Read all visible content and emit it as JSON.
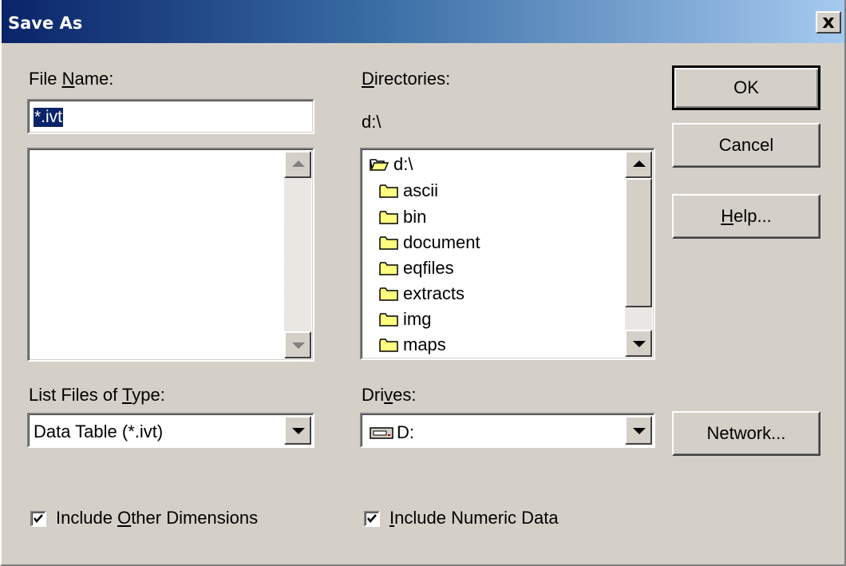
{
  "window": {
    "title": "Save As",
    "close_glyph": "x"
  },
  "file_name": {
    "label_pre": "File ",
    "label_key": "N",
    "label_post": "ame:",
    "value": "*.ivt"
  },
  "directories": {
    "label_pre": "",
    "label_key": "D",
    "label_post": "irectories:",
    "current_path": "d:\\",
    "items": [
      {
        "name": "d:\\",
        "icon": "open-folder-icon"
      },
      {
        "name": "ascii",
        "icon": "folder-icon"
      },
      {
        "name": "bin",
        "icon": "folder-icon"
      },
      {
        "name": "document",
        "icon": "folder-icon"
      },
      {
        "name": "eqfiles",
        "icon": "folder-icon"
      },
      {
        "name": "extracts",
        "icon": "folder-icon"
      },
      {
        "name": "img",
        "icon": "folder-icon"
      },
      {
        "name": "maps",
        "icon": "folder-icon"
      }
    ]
  },
  "file_type": {
    "label_pre": "List Files of ",
    "label_key": "T",
    "label_post": "ype:",
    "value": "Data Table (*.ivt)"
  },
  "drives": {
    "label_pre": "Dri",
    "label_key": "v",
    "label_post": "es:",
    "value": "D:",
    "icon": "drive-icon"
  },
  "buttons": {
    "ok": "OK",
    "cancel": "Cancel",
    "help_key": "H",
    "help_rest": "elp...",
    "network": "Network..."
  },
  "options": {
    "other_dims_pre": "Include ",
    "other_dims_key": "O",
    "other_dims_post": "ther Dimensions",
    "other_dims_checked": true,
    "numeric_key": "I",
    "numeric_post": "nclude Numeric Data",
    "numeric_checked": true
  },
  "colors": {
    "title_start": "#0a246a",
    "title_end": "#a6caf0",
    "face": "#d4d0c8",
    "selection": "#0a246a",
    "folder": "#ffff80"
  }
}
